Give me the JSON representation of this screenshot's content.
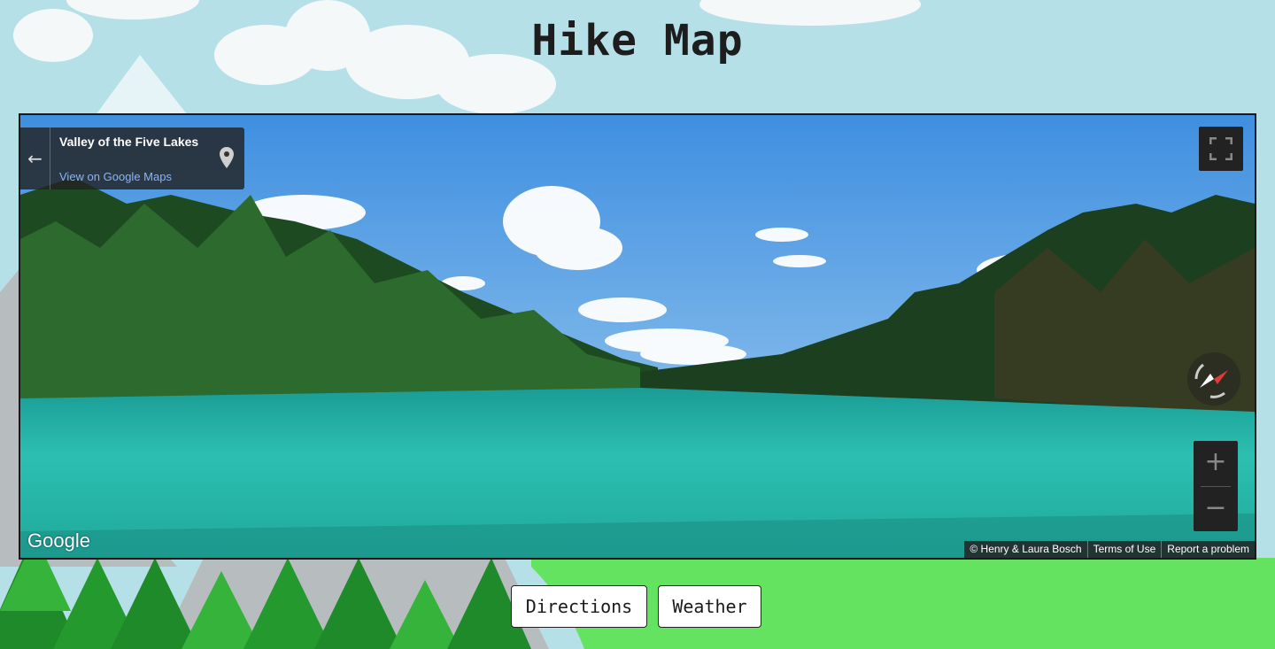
{
  "page": {
    "title": "Hike Map"
  },
  "streetview": {
    "place_name": "Valley of the Five Lakes",
    "view_link": "View on Google Maps",
    "back_icon": "←",
    "zoom_in": "+",
    "zoom_out": "−",
    "google_logo": "Google",
    "attribution": {
      "credit": "© Henry & Laura Bosch",
      "terms": "Terms of Use",
      "report": "Report a problem"
    }
  },
  "buttons": {
    "directions": "Directions",
    "weather": "Weather"
  },
  "colors": {
    "sky": "#b6e0e8",
    "grass": "#63e35f",
    "tree_dark": "#1f8a2a",
    "tree_light": "#35b33a",
    "mountain": "#b7bcbf"
  },
  "icons": [
    "back-arrow-icon",
    "map-pin-icon",
    "fullscreen-icon",
    "compass-icon"
  ]
}
